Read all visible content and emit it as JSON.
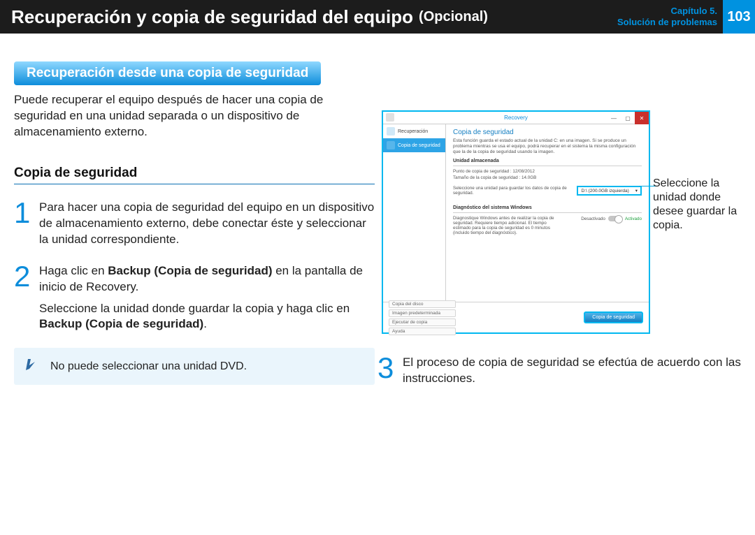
{
  "header": {
    "title": "Recuperación y copia de seguridad del equipo",
    "subtitle": "(Opcional)",
    "chapter_line1": "Capítulo 5.",
    "chapter_line2": "Solución de problemas",
    "page_number": "103"
  },
  "section_tab": "Recuperación desde una copia de seguridad",
  "intro": "Puede recuperar el equipo después de hacer una copia de seguridad en una unidad separada o un dispositivo de almacenamiento externo.",
  "sub_heading": "Copia de seguridad",
  "steps": {
    "s1": {
      "num": "1",
      "text": "Para hacer una copia de seguridad del equipo en un dispositivo de almacenamiento externo, debe conectar éste y seleccionar la unidad correspondiente."
    },
    "s2": {
      "num": "2",
      "p1_a": "Haga clic en ",
      "p1_bold": "Backup (Copia de seguridad)",
      "p1_b": " en la pantalla de inicio de Recovery.",
      "p2_a": "Seleccione la unidad donde guardar la copia y haga clic en ",
      "p2_bold": "Backup (Copia de seguridad)",
      "p2_b": "."
    },
    "s3": {
      "num": "3",
      "text": "El proceso de copia de seguridad se efectúa de acuerdo con las instrucciones."
    }
  },
  "note": "No puede seleccionar una unidad DVD.",
  "callout": "Seleccione la unidad donde desee guardar la copia.",
  "app": {
    "title": "Recovery",
    "sidebar": {
      "item0": "Recuperación",
      "item1": "Copia de seguridad"
    },
    "main_title": "Copia de seguridad",
    "desc": "Esta función guarda el estado actual de la unidad C: en una imagen. Si se produce un problema mientras se usa el equipo, podrá recuperar en el sistema la misma configuración que la de la copia de seguridad usando la imagen.",
    "storage_title": "Unidad almacenada",
    "line1": "Punto de copia de seguridad : 12/08/2012",
    "line2": "Tamaño de la copia de seguridad : 14.0GB",
    "line3": "Seleccione una unidad para guardar los datos de copia de seguridad.",
    "drive_value": "D:\\ (200.0GB izquierda)",
    "diag_title": "Diagnóstico del sistema Windows",
    "diag_text": "Diagnostique Windows antes de realizar la copia de seguridad. Requiere tiempo adicional. El tiempo estimado para la copia de seguridad es 0 minutos (incluido tiempo del diagnóstico).",
    "toggle_off": "Desactivado",
    "toggle_on": "Activado",
    "foot1": "Copia del disco",
    "foot2": "Imagen predeterminada",
    "foot3": "Ejecutar de copia",
    "foot4": "Ayuda",
    "backup_btn": "Copia de seguridad"
  }
}
